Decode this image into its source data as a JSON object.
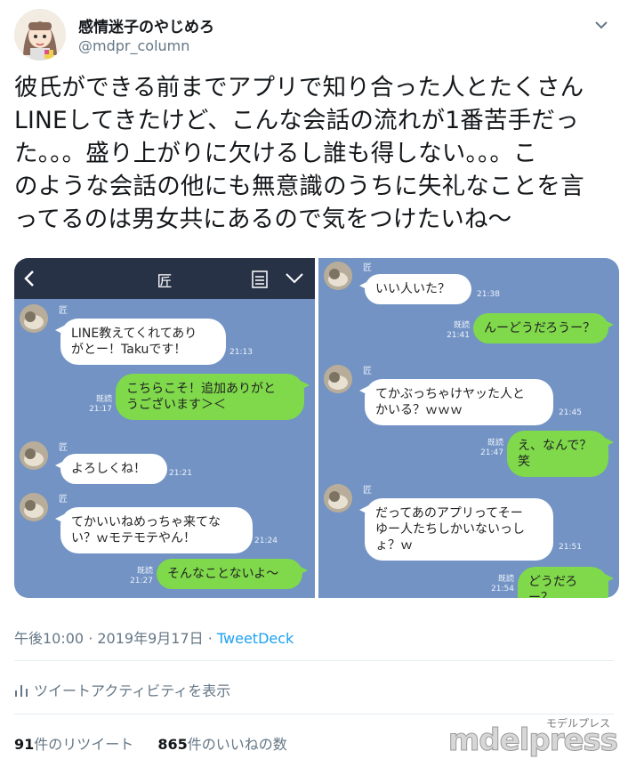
{
  "user": {
    "display_name": "感情迷子のやじめろ",
    "handle": "@mdpr_column"
  },
  "tweet_text": "彼氏ができる前までアプリで知り合った人とたくさん\nLINEしてきたけど、こんな会話の流れが1番苦手だっ\nた。。。盛り上がりに欠けるし誰も得しない。。。こ\nのような会話の他にも無意識のうちに失礼なことを言\nってるのは男女共にあるので気をつけたいね〜",
  "chat_left": {
    "title": "匠",
    "sender": "匠",
    "messages": [
      {
        "text": "LINE教えてくれてあり\nがとー！Takuです！",
        "time": "21:13"
      },
      {
        "read": "既読",
        "time": "21:17",
        "text": "こちらこそ！追加ありがと\nうございます＞＜"
      },
      {
        "text": "よろしくね！",
        "time": "21:21"
      },
      {
        "text": "てかいいねめっちゃ来てな\nい？ｗモテモテやん！",
        "time": "21:24"
      },
      {
        "read": "既読",
        "time": "21:27",
        "text": "そんなことないよ〜"
      }
    ]
  },
  "chat_right": {
    "sender": "匠",
    "messages": [
      {
        "text": "いい人いた？",
        "time": "21:38"
      },
      {
        "read": "既読",
        "time": "21:41",
        "text": "んーどうだろうー？"
      },
      {
        "text": "てかぶっちゃけヤッた人と\nかいる？ｗｗｗ",
        "time": "21:45"
      },
      {
        "read": "既読",
        "time": "21:47",
        "text": "え、なんで？笑"
      },
      {
        "text": "だってあのアプリってそー\nゆー人たちしかいないっし\nょ？ｗ",
        "time": "21:51"
      },
      {
        "read": "既読",
        "time": "21:54",
        "text": "どうだろー？"
      }
    ]
  },
  "meta": {
    "timestamp": "午後10:00 · 2019年9月17日 · ",
    "client": "TweetDeck"
  },
  "activity_label": "ツイートアクティビティを表示",
  "stats": {
    "retweet_count": "91",
    "retweet_label": "件のリツイート",
    "like_count": "865",
    "like_label": "件のいいねの数"
  },
  "watermark": {
    "small": "モデルプレス",
    "large": "mdelpress"
  },
  "colors": {
    "chat_bg": "#7293c4",
    "chat_header": "#283246",
    "out_bubble": "#7fd94b",
    "link": "#1da1f2"
  }
}
